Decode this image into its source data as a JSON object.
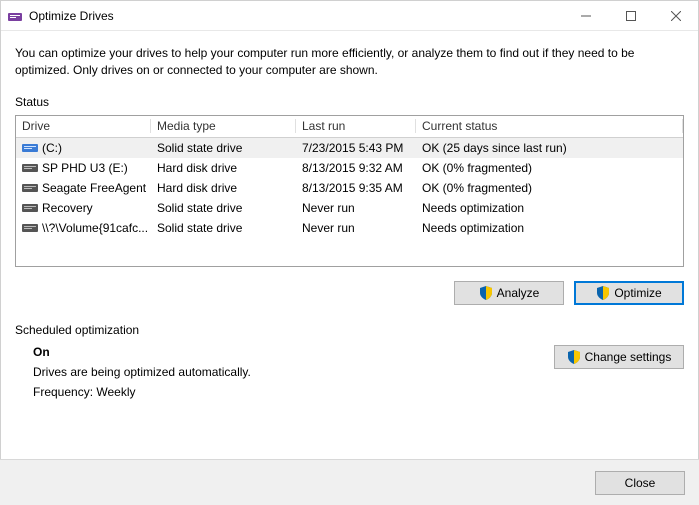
{
  "window": {
    "title": "Optimize Drives"
  },
  "intro": "You can optimize your drives to help your computer run more efficiently, or analyze them to find out if they need to be optimized. Only drives on or connected to your computer are shown.",
  "status_label": "Status",
  "columns": {
    "drive": "Drive",
    "media": "Media type",
    "lastrun": "Last run",
    "status": "Current status"
  },
  "drives": [
    {
      "name": "(C:)",
      "media": "Solid state drive",
      "lastrun": "7/23/2015 5:43 PM",
      "status": "OK (25 days since last run)",
      "selected": true,
      "icon": "ssd"
    },
    {
      "name": "SP PHD U3 (E:)",
      "media": "Hard disk drive",
      "lastrun": "8/13/2015 9:32 AM",
      "status": "OK (0% fragmented)",
      "selected": false,
      "icon": "hdd"
    },
    {
      "name": "Seagate FreeAgent",
      "media": "Hard disk drive",
      "lastrun": "8/13/2015 9:35 AM",
      "status": "OK (0% fragmented)",
      "selected": false,
      "icon": "hdd"
    },
    {
      "name": "Recovery",
      "media": "Solid state drive",
      "lastrun": "Never run",
      "status": "Needs optimization",
      "selected": false,
      "icon": "hdd"
    },
    {
      "name": "\\\\?\\Volume{91cafc...",
      "media": "Solid state drive",
      "lastrun": "Never run",
      "status": "Needs optimization",
      "selected": false,
      "icon": "hdd"
    }
  ],
  "buttons": {
    "analyze": "Analyze",
    "optimize": "Optimize",
    "change_settings": "Change settings",
    "close": "Close"
  },
  "scheduled": {
    "label": "Scheduled optimization",
    "state": "On",
    "desc": "Drives are being optimized automatically.",
    "freq": "Frequency: Weekly"
  }
}
